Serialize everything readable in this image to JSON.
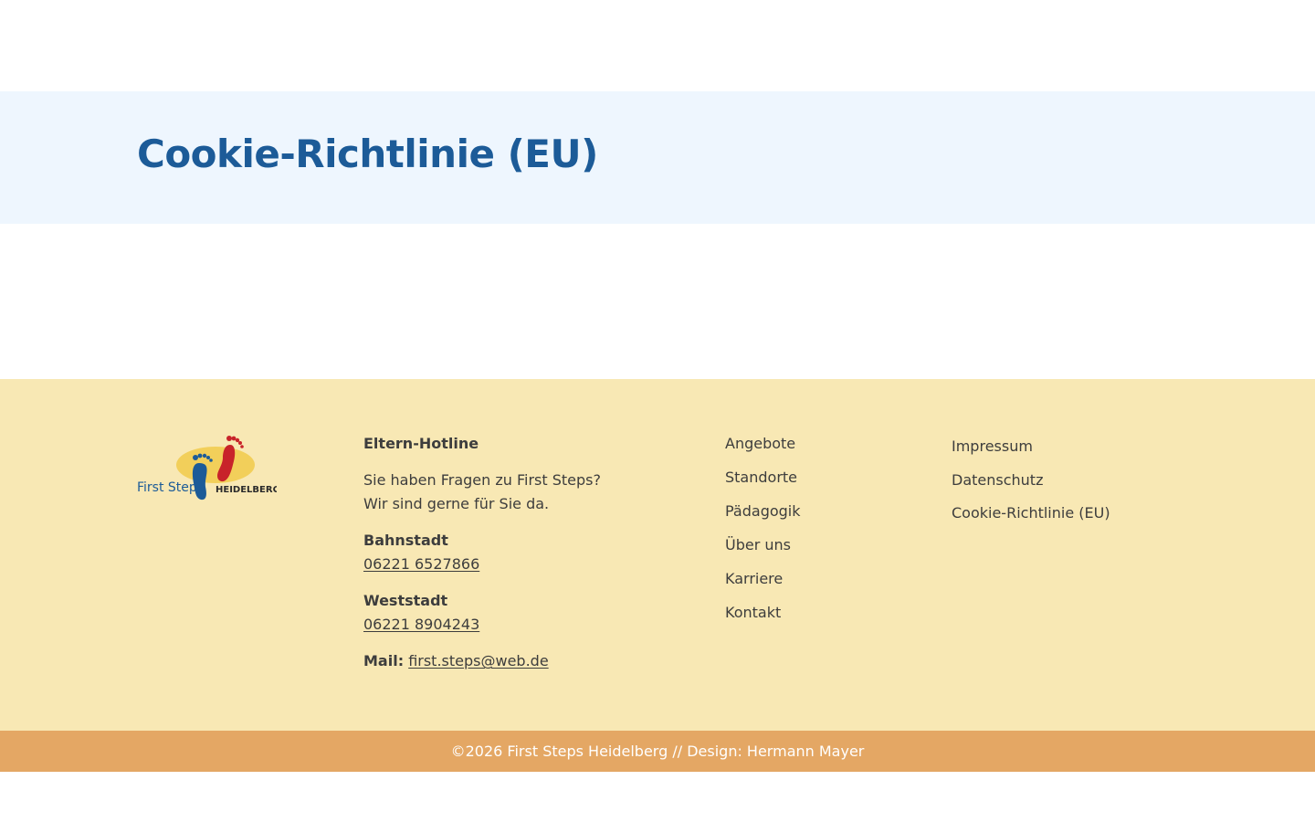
{
  "page": {
    "title": "Cookie-Richtlinie (EU)"
  },
  "footer": {
    "logo": {
      "icon": "footprints-logo-icon",
      "text_first_steps": "First Steps",
      "text_city": "HEIDELBERG"
    },
    "contact": {
      "heading": "Eltern-Hotline",
      "intro_line1": "Sie haben Fragen zu First Steps?",
      "intro_line2": "Wir sind gerne für Sie da.",
      "locations": [
        {
          "name": "Bahnstadt",
          "phone": "06221 6527866"
        },
        {
          "name": "Weststadt",
          "phone": "06221 8904243"
        }
      ],
      "mail_label": "Mail:",
      "mail": "first.steps@web.de"
    },
    "nav": [
      {
        "label": "Angebote"
      },
      {
        "label": "Standorte"
      },
      {
        "label": "Pädagogik"
      },
      {
        "label": "Über uns"
      },
      {
        "label": "Karriere"
      },
      {
        "label": "Kontakt"
      }
    ],
    "legal": [
      {
        "label": "Impressum"
      },
      {
        "label": "Datenschutz"
      },
      {
        "label": "Cookie-Richtlinie (EU)"
      }
    ],
    "copyright": "©2026 First Steps Heidelberg // Design: Hermann Mayer"
  },
  "colors": {
    "title": "#1c5b98",
    "hero_bg": "#eef6fe",
    "footer_bg": "#f8e8b4",
    "copyright_bg": "#e4a764",
    "logo_blue": "#1c5b98",
    "logo_red": "#c8232a",
    "logo_yellow": "#f2cf5a"
  }
}
